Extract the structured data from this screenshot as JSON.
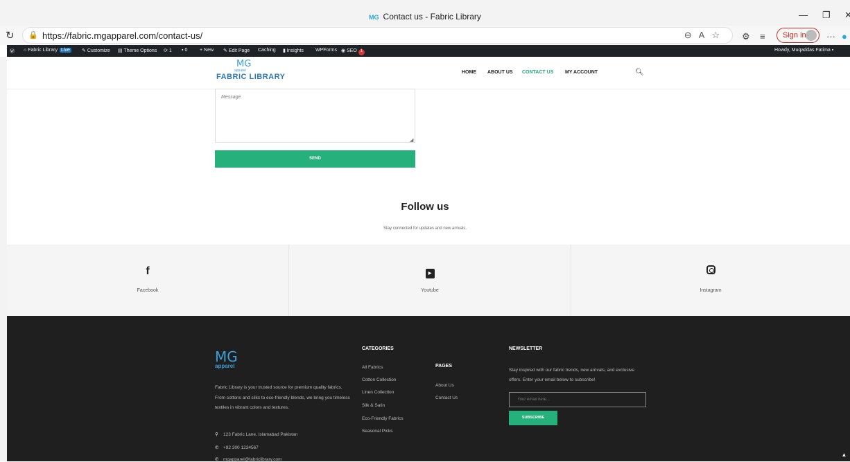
{
  "browser": {
    "tab_title": "Contact us - Fabric Library",
    "favicon_text": "MG",
    "url": "https://fabric.mgapparel.com/contact-us/",
    "sign_in": "Sign in"
  },
  "adminbar": {
    "site": "Fabric Library",
    "live": "Live",
    "customize": "Customize",
    "theme_options": "Theme Options",
    "updates": "1",
    "comments": "0",
    "new": "New",
    "edit_page": "Edit Page",
    "caching": "Caching",
    "insights": "Insights",
    "wpforms": "WPForms",
    "seo": "SEO",
    "seo_count": "1",
    "howdy": "Howdy, Muqaddas Fatima"
  },
  "header": {
    "logo_mg": "MG",
    "logo_sub": "apparel",
    "logo_text": "FABRIC LIBRARY",
    "nav": [
      "HOME",
      "ABOUT US",
      "CONTACT US",
      "MY ACCOUNT"
    ]
  },
  "form": {
    "message_placeholder": "Message",
    "send_label": "SEND"
  },
  "follow": {
    "title": "Follow us",
    "subtitle": "Stay connected for updates and new arrivals.",
    "items": [
      {
        "label": "Facebook",
        "icon": "facebook-icon"
      },
      {
        "label": "Youtube",
        "icon": "youtube-icon"
      },
      {
        "label": "Instagram",
        "icon": "instagram-icon"
      }
    ]
  },
  "footer": {
    "logo_mg": "MG",
    "logo_sub": "apparel",
    "about_1": "Fabric Library is your trusted source for premium quality fabrics.",
    "about_2": "From cottons and silks to eco-friendly blends, we bring you timeless textiles in vibrant colors and textures.",
    "address": "123 Fabric Lane, Islamabad Pakistan",
    "phone": "+92 300 1234567",
    "email": "mgapparel@fabriclibrary.com",
    "categories_title": "CATEGORIES",
    "categories": [
      "All Fabrics",
      "Cotton Collection",
      "Linen Collection",
      "Silk & Satin",
      "Eco-Friendly Fabrics",
      "Seasonal Picks"
    ],
    "pages_title": "PAGES",
    "pages": [
      "About Us",
      "Contact Us"
    ],
    "newsletter_title": "NEWSLETTER",
    "newsletter_text": "Stay inspired with our fabric trends, new arrivals, and exclusive offers. Enter your email below to subscribe!",
    "email_placeholder": "Your email here...",
    "subscribe_label": "SUBSCRIBE"
  },
  "colors": {
    "accent": "#26b07b",
    "logo_blue": "#3a9fd8",
    "footer_bg": "#1f1f1f"
  }
}
